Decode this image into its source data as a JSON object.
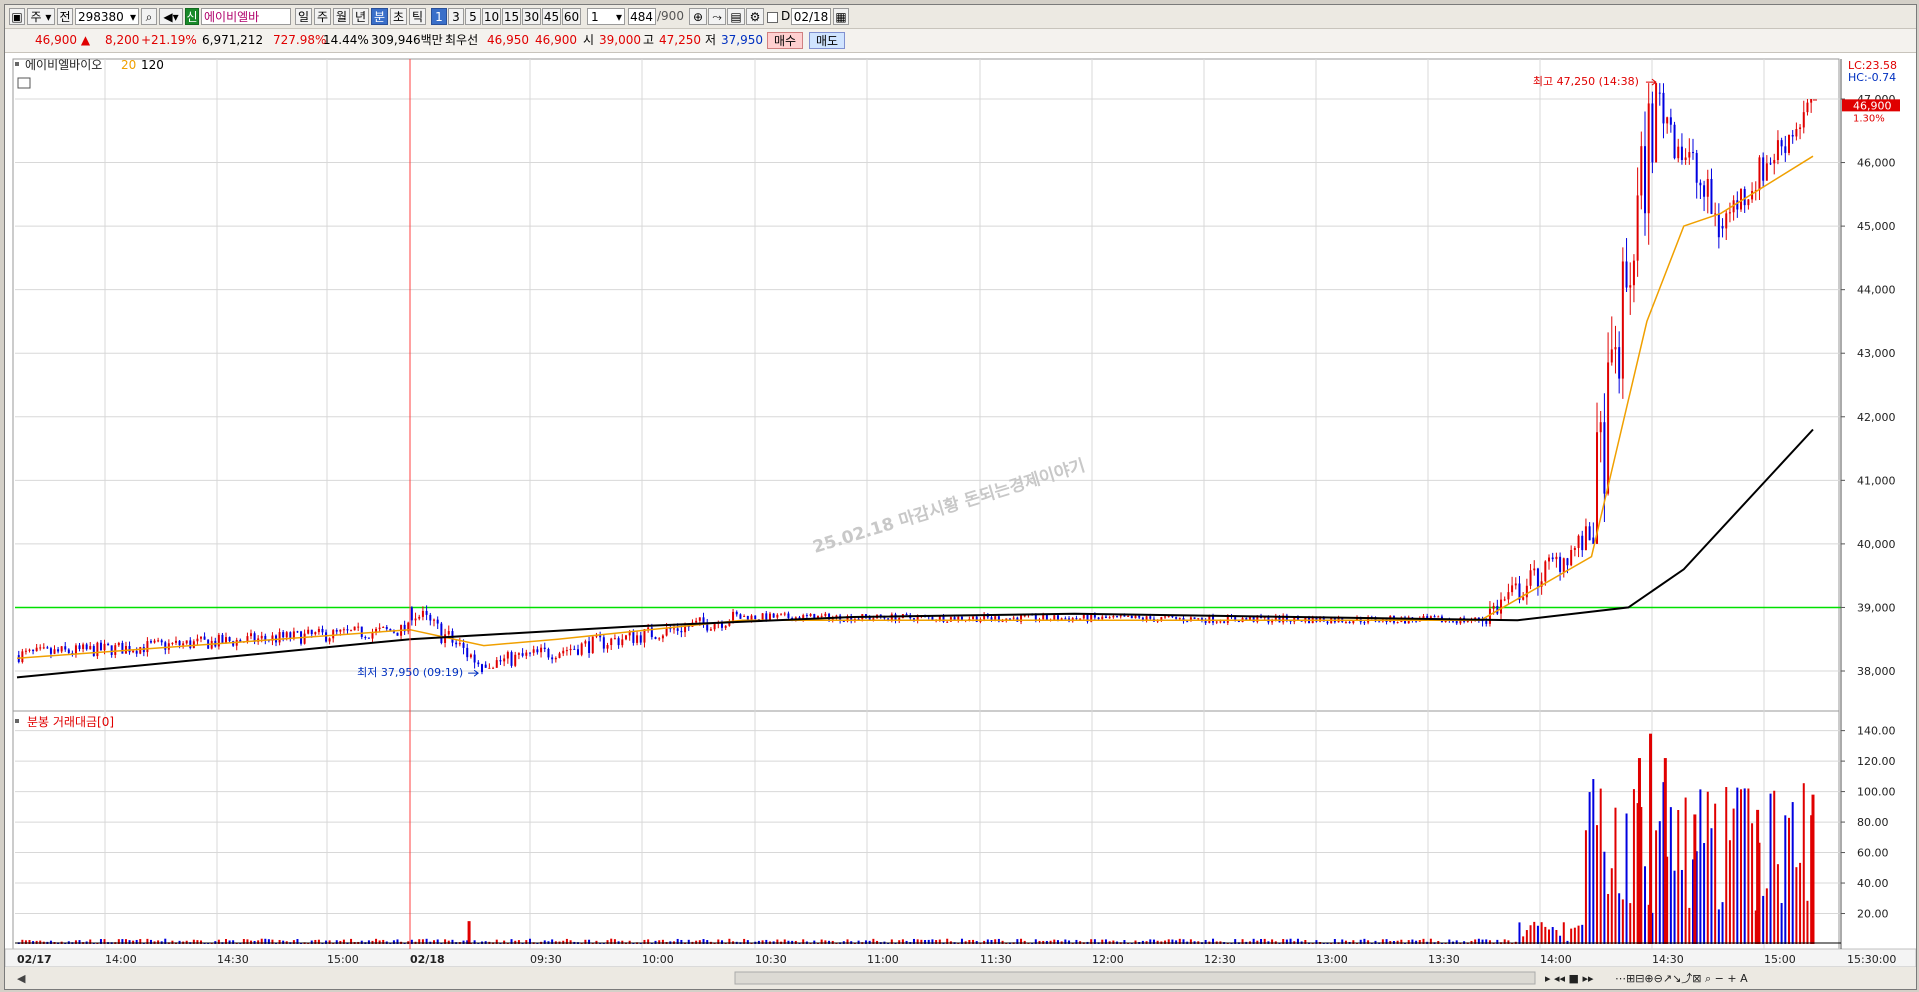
{
  "toolbar": {
    "type_label": "주",
    "mode_label": "전",
    "stock_code": "298380",
    "stock_name": "에이비엘바",
    "credit_badge": "신",
    "period_buttons": [
      "일",
      "주",
      "월",
      "년",
      "분",
      "초",
      "틱"
    ],
    "minute_buttons": [
      "1",
      "3",
      "5",
      "10",
      "15",
      "30",
      "45",
      "60"
    ],
    "interval_value": "1",
    "count_value": "484",
    "count_max": "/900",
    "date_label": "D",
    "date_value": "02/18"
  },
  "quote": {
    "price": "46,900",
    "arrow": "▲",
    "change": "8,200",
    "change_pct": "+21.19%",
    "volume": "6,971,212",
    "volume_ratio": "727.98%",
    "turnover_pct": "14.44%",
    "trade_value": "309,946백만",
    "best_bid_label": "최우선",
    "best_ask": "46,950",
    "best_bid": "46,900",
    "open_label": "시",
    "open": "39,000",
    "high_label": "고",
    "high": "47,250",
    "low_label": "저",
    "low": "37,950",
    "buy_button": "매수",
    "sell_button": "매도"
  },
  "colors": {
    "up": "#e00000",
    "down": "#0000e0",
    "ma20": "#f0a000",
    "ma120": "#000000",
    "ref_line": "#00e000",
    "grid": "#d8d8d8"
  },
  "price_panel": {
    "title": "에이비엘바이오",
    "ma_short": "20",
    "ma_long": "120",
    "lc_label": "LC:23.58",
    "hc_label": "HC:-0.74",
    "current_badge": "46,900",
    "current_pct": "1.30%",
    "high_annotation": "최고 47,250 (14:38)",
    "low_annotation": "최저 37,950 (09:19)",
    "watermark": "25.02.18 마감시황 돈되는경제이야기"
  },
  "volume_panel": {
    "title": "분봉 거래대금[0]"
  },
  "chart_data": [
    {
      "type": "candlestick",
      "title": "에이비엘바이오",
      "interval": "1 minute",
      "x_tick_labels": [
        "02/17",
        "14:00",
        "14:30",
        "15:00",
        "02/18",
        "09:30",
        "10:00",
        "10:30",
        "11:00",
        "11:30",
        "12:00",
        "12:30",
        "13:00",
        "13:30",
        "14:00",
        "14:30",
        "15:00",
        "15:30:00"
      ],
      "y_tick_labels": [
        "47,000",
        "46,000",
        "45,000",
        "44,000",
        "43,000",
        "42,000",
        "41,000",
        "40,000",
        "39,000",
        "38,000"
      ],
      "ylim": [
        37700,
        47600
      ],
      "reference_line": 39000,
      "high": {
        "value": 47250,
        "time": "14:38"
      },
      "low": {
        "value": 37950,
        "time": "09:19"
      },
      "last": 46900,
      "phases": [
        {
          "session": "02/17",
          "from": "13:40",
          "to": "15:30",
          "open": 38250,
          "close": 38650,
          "min": 38000,
          "max": 38900
        },
        {
          "session": "02/18",
          "from": "09:00",
          "to": "09:20",
          "open": 39000,
          "close": 38100,
          "min": 37950,
          "max": 39300
        },
        {
          "session": "02/18",
          "from": "09:20",
          "to": "10:30",
          "open": 38100,
          "close": 38850,
          "min": 38050,
          "max": 39100
        },
        {
          "session": "02/18",
          "from": "10:30",
          "to": "13:50",
          "open": 38850,
          "close": 38800,
          "min": 38550,
          "max": 39050
        },
        {
          "session": "02/18",
          "from": "13:50",
          "to": "14:20",
          "open": 38800,
          "close": 40100,
          "min": 38700,
          "max": 40500
        },
        {
          "session": "02/18",
          "from": "14:20",
          "to": "14:38",
          "open": 40100,
          "close": 47100,
          "min": 40000,
          "max": 47250
        },
        {
          "session": "02/18",
          "from": "14:38",
          "to": "14:55",
          "open": 47100,
          "close": 45000,
          "min": 43900,
          "max": 47250
        },
        {
          "session": "02/18",
          "from": "14:55",
          "to": "15:20",
          "open": 45000,
          "close": 46900,
          "min": 44700,
          "max": 47000
        }
      ],
      "series": [
        {
          "name": "20",
          "values_points": [
            [
              "02/17 13:40",
              38200
            ],
            [
              "02/17 15:30",
              38650
            ],
            [
              "02/18 09:20",
              38400
            ],
            [
              "02/18 09:40",
              38500
            ],
            [
              "02/18 10:30",
              38800
            ],
            [
              "02/18 13:50",
              38800
            ],
            [
              "02/18 14:20",
              39800
            ],
            [
              "02/18 14:35",
              43500
            ],
            [
              "02/18 14:45",
              45000
            ],
            [
              "02/18 14:55",
              45200
            ],
            [
              "02/18 15:20",
              46100
            ]
          ]
        },
        {
          "name": "120",
          "values_points": [
            [
              "02/17 13:40",
              37900
            ],
            [
              "02/18 09:00",
              38500
            ],
            [
              "02/18 10:00",
              38700
            ],
            [
              "02/18 11:00",
              38850
            ],
            [
              "02/18 12:00",
              38900
            ],
            [
              "02/18 13:00",
              38850
            ],
            [
              "02/18 14:00",
              38800
            ],
            [
              "02/18 14:30",
              39000
            ],
            [
              "02/18 14:45",
              39600
            ],
            [
              "02/18 15:20",
              41800
            ]
          ]
        }
      ]
    },
    {
      "type": "bar",
      "title": "분봉 거래대금[0]",
      "y_tick_labels": [
        "140.00",
        "120.00",
        "100.00",
        "80.00",
        "60.00",
        "40.00",
        "20.00"
      ],
      "ylim": [
        0,
        145
      ],
      "peaks": [
        {
          "time": "09:16",
          "value": 15
        },
        {
          "time": "14:33",
          "value": 122
        },
        {
          "time": "14:36",
          "value": 138
        },
        {
          "time": "14:40",
          "value": 122
        },
        {
          "time": "14:48",
          "value": 85
        },
        {
          "time": "15:05",
          "value": 88
        },
        {
          "time": "15:20",
          "value": 98
        }
      ]
    }
  ]
}
